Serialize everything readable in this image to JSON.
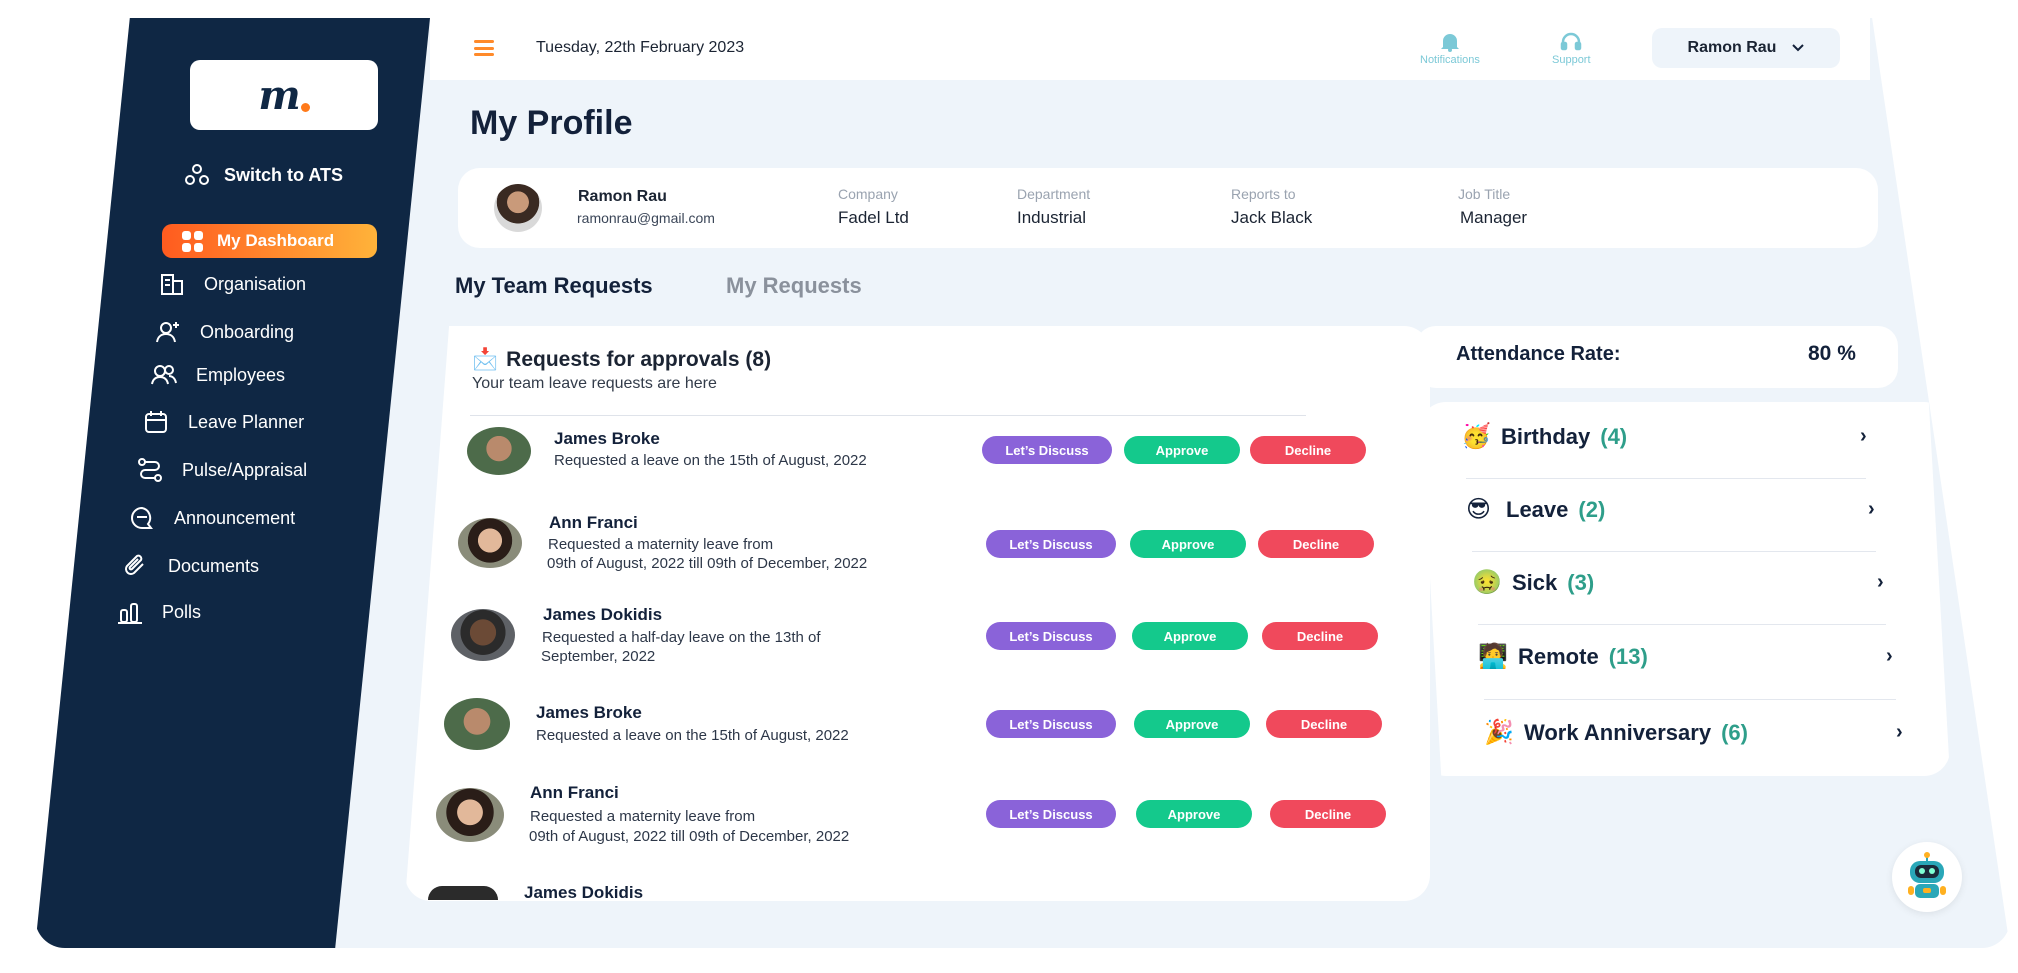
{
  "header": {
    "date": "Tuesday, 22th February 2023",
    "notifications_label": "Notifications",
    "support_label": "Support",
    "user_name": "Ramon Rau"
  },
  "sidebar": {
    "logo_text": "m",
    "switch_ats": "Switch to ATS",
    "active_item": "My Dashboard",
    "items": [
      {
        "label": "Organisation",
        "icon": "building-icon"
      },
      {
        "label": "Onboarding",
        "icon": "user-plus-icon"
      },
      {
        "label": "Employees",
        "icon": "users-icon"
      },
      {
        "label": "Leave Planner",
        "icon": "calendar-icon"
      },
      {
        "label": "Pulse/Appraisal",
        "icon": "route-icon"
      },
      {
        "label": "Announcement",
        "icon": "chat-icon"
      },
      {
        "label": "Documents",
        "icon": "paperclip-icon"
      },
      {
        "label": "Polls",
        "icon": "bar-chart-icon"
      }
    ]
  },
  "page": {
    "title": "My Profile"
  },
  "profile": {
    "name": "Ramon Rau",
    "email": "ramonrau@gmail.com",
    "company_label": "Company",
    "company": "Fadel Ltd",
    "department_label": "Department",
    "department": "Industrial",
    "reports_label": "Reports to",
    "reports_to": "Jack Black",
    "job_title_label": "Job Title",
    "job_title": "Manager"
  },
  "tabs": {
    "team": "My Team Requests",
    "mine": "My Requests"
  },
  "requests": {
    "title": "Requests for approvals (8)",
    "subtitle": "Your team leave requests are here",
    "discuss_label": "Let’s Discuss",
    "approve_label": "Approve",
    "decline_label": "Decline",
    "items": [
      {
        "name": "James Broke",
        "line1": "Requested a leave on the 15th of August, 2022",
        "line2": ""
      },
      {
        "name": "Ann Franci",
        "line1": "Requested a maternity leave from",
        "line2": "09th of August, 2022 till 09th of December, 2022"
      },
      {
        "name": "James Dokidis",
        "line1": "Requested a half-day leave on the 13th of",
        "line2": "September, 2022"
      },
      {
        "name": "James Broke",
        "line1": "Requested a leave on the 15th of August, 2022",
        "line2": ""
      },
      {
        "name": "Ann Franci",
        "line1": "Requested a maternity leave from",
        "line2": "09th of August, 2022 till 09th of December, 2022"
      },
      {
        "name": "James Dokidis",
        "line1": "",
        "line2": ""
      }
    ]
  },
  "attendance": {
    "label": "Attendance Rate:",
    "value": "80 %"
  },
  "categories": [
    {
      "emoji": "🥳",
      "label": "Birthday",
      "count": "(4)"
    },
    {
      "emoji": "😎",
      "label": "Leave",
      "count": "(2)"
    },
    {
      "emoji": "🤢",
      "label": "Sick",
      "count": "(3)"
    },
    {
      "emoji": "🧑‍💻",
      "label": "Remote",
      "count": "(13)"
    },
    {
      "emoji": "🎉",
      "label": "Work Anniversary",
      "count": "(6)"
    }
  ],
  "colors": {
    "sidebar_bg": "#0f2744",
    "accent_orange": "#ff5b1f",
    "discuss": "#8a63d9",
    "approve": "#14c98c",
    "decline": "#f0495c",
    "count_teal": "#2e9e8a"
  }
}
